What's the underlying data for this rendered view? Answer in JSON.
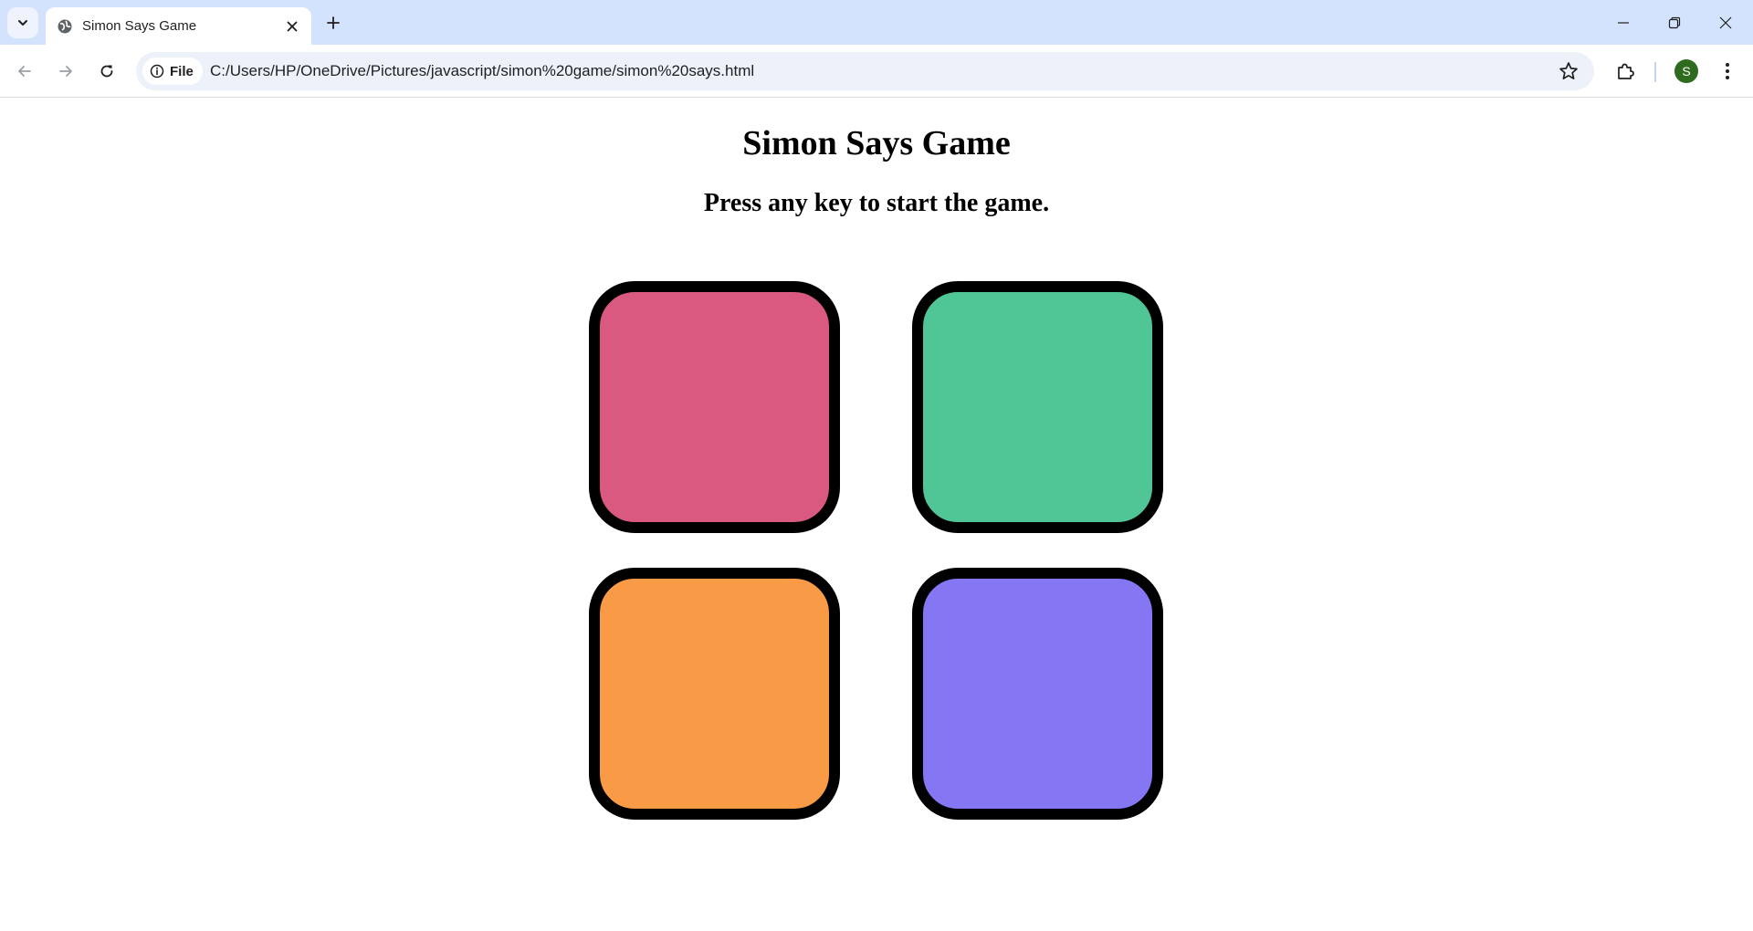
{
  "browser": {
    "tab": {
      "title": "Simon Says Game"
    },
    "omnibox": {
      "chip_label": "File",
      "url": "C:/Users/HP/OneDrive/Pictures/javascript/simon%20game/simon%20says.html"
    },
    "profile": {
      "initial": "S",
      "color": "#2e6b1f"
    }
  },
  "page": {
    "title": "Simon Says Game",
    "status": "Press any key to start the game."
  },
  "buttons": [
    {
      "id": "red",
      "color": "#d95980"
    },
    {
      "id": "green",
      "color": "#50c595"
    },
    {
      "id": "orange",
      "color": "#f89a46"
    },
    {
      "id": "purple",
      "color": "#8576f3"
    }
  ]
}
